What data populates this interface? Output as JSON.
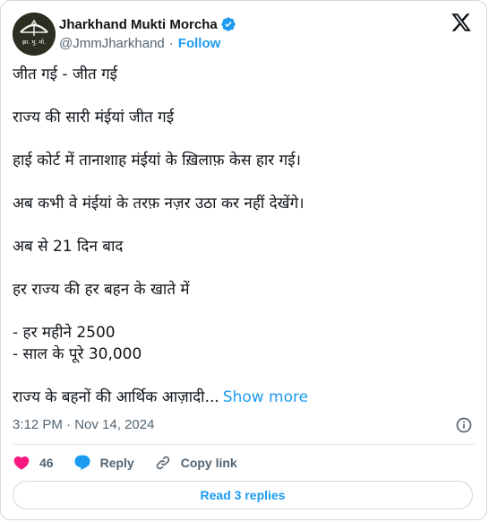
{
  "author": {
    "name": "Jharkhand Mukti Morcha",
    "handle": "@JmmJharkhand",
    "follow_label": "Follow",
    "avatar_text": "झा. मु. मो.",
    "verified_icon": "verified-badge-icon"
  },
  "tweet": {
    "paragraphs": [
      [
        "जीत गई - जीत गई"
      ],
      [
        "राज्य की सारी मंईयां जीत गई"
      ],
      [
        "हाई कोर्ट में तानाशाह मंईयां के ख़िलाफ़ केस हार गई।"
      ],
      [
        "अब कभी वे मंईयां के तरफ़ नज़र उठा कर नहीं देखेंगे।"
      ],
      [
        "अब से 21 दिन बाद"
      ],
      [
        "हर राज्य की हर बहन के खाते में"
      ],
      [
        "- हर महीने 2500",
        "- साल के पूरे 30,000"
      ]
    ],
    "last_line": "राज्य के बहनों की आर्थिक आज़ादी...",
    "show_more_label": "Show more",
    "timestamp": "3:12 PM · Nov 14, 2024"
  },
  "actions": {
    "like_count": "46",
    "reply_label": "Reply",
    "copy_link_label": "Copy link",
    "read_replies_label": "Read 3 replies"
  },
  "colors": {
    "accent": "#1d9bf0",
    "like": "#f91880",
    "muted": "#536471",
    "text": "#0f1419"
  }
}
